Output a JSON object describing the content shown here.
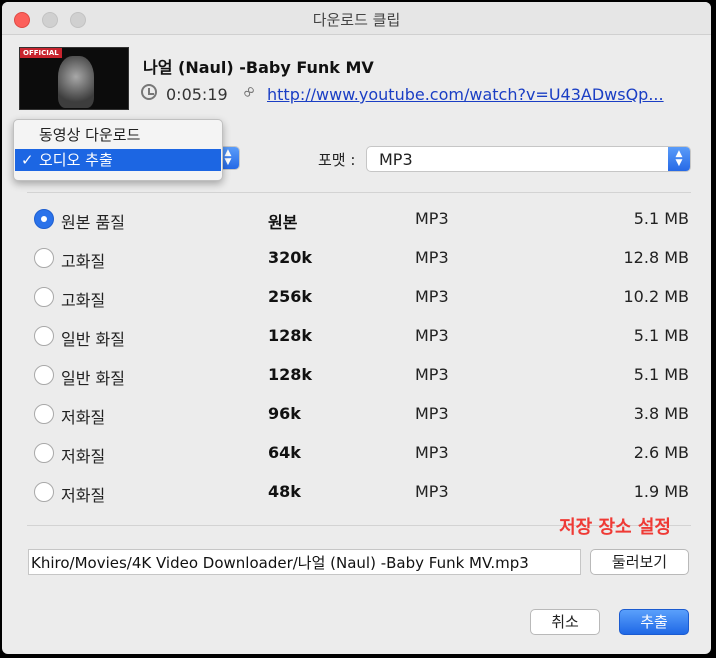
{
  "window": {
    "title": "다운로드 클립"
  },
  "video": {
    "badge": "OFFICIAL",
    "title": "나얼 (Naul) -Baby Funk MV",
    "duration": "0:05:19",
    "url": "http://www.youtube.com/watch?v=U43ADwsQp..."
  },
  "mode_menu": {
    "items": [
      {
        "label": "동영상 다운로드",
        "selected": false
      },
      {
        "label": "오디오 추출",
        "selected": true
      }
    ],
    "check_glyph": "✓"
  },
  "format": {
    "label": "포맷 :",
    "value": "MP3"
  },
  "qualities": [
    {
      "label": "원본 품질",
      "bitrate": "원본",
      "ext": "MP3",
      "size": "5.1 MB",
      "selected": true
    },
    {
      "label": "고화질",
      "bitrate": "320k",
      "ext": "MP3",
      "size": "12.8 MB",
      "selected": false
    },
    {
      "label": "고화질",
      "bitrate": "256k",
      "ext": "MP3",
      "size": "10.2 MB",
      "selected": false
    },
    {
      "label": "일반 화질",
      "bitrate": "128k",
      "ext": "MP3",
      "size": "5.1 MB",
      "selected": false
    },
    {
      "label": "일반 화질",
      "bitrate": "128k",
      "ext": "MP3",
      "size": "5.1 MB",
      "selected": false
    },
    {
      "label": "저화질",
      "bitrate": "96k",
      "ext": "MP3",
      "size": "3.8 MB",
      "selected": false
    },
    {
      "label": "저화질",
      "bitrate": "64k",
      "ext": "MP3",
      "size": "2.6 MB",
      "selected": false
    },
    {
      "label": "저화질",
      "bitrate": "48k",
      "ext": "MP3",
      "size": "1.9 MB",
      "selected": false
    }
  ],
  "save": {
    "annotation": "저장 장소 설정",
    "path": "Khiro/Movies/4K Video Downloader/나얼 (Naul) -Baby Funk MV.mp3",
    "browse_label": "둘러보기"
  },
  "actions": {
    "cancel_label": "취소",
    "extract_label": "추출"
  },
  "colors": {
    "accent": "#1c66e3",
    "annotation": "#ef3a35",
    "close": "#fc605b"
  }
}
